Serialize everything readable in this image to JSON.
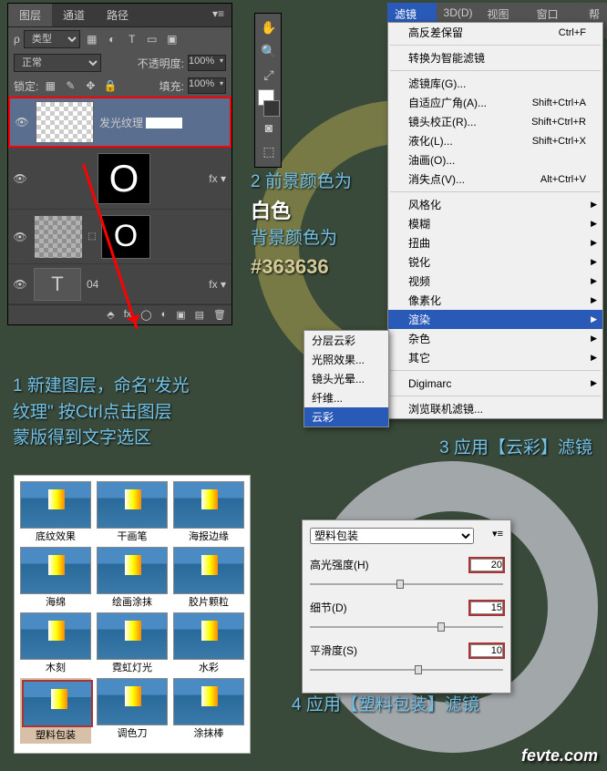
{
  "layers_panel": {
    "tabs": [
      "图层",
      "通道",
      "路径"
    ],
    "kind_label": "类型",
    "blend_mode": "正常",
    "opacity_label": "不透明度:",
    "opacity_value": "100%",
    "lock_label": "锁定:",
    "fill_label": "填充:",
    "fill_value": "100%",
    "layers": [
      {
        "name": "发光纹理",
        "red": true,
        "checker": true,
        "mask": "white",
        "fx": ""
      },
      {
        "name": "",
        "checker": false,
        "mask": "O-black",
        "fx": "fx ▾"
      },
      {
        "name": "",
        "checker": true,
        "mask": "O-black",
        "fx": ""
      },
      {
        "name": "04",
        "type": "T",
        "fx": "fx ▾"
      }
    ]
  },
  "tools": {
    "icons": [
      "✋",
      "🔍",
      "⤢",
      "⬚",
      "⬚",
      "⬚"
    ]
  },
  "swatches": {
    "fg": "#ffffff",
    "bg": "#363636"
  },
  "anno1": {
    "line1": "2 前景颜色为",
    "line2": "白色",
    "line3": "背景颜色为",
    "line4": "#363636"
  },
  "anno2": {
    "line1": "1 新建图层，命名\"发光",
    "line2": "纹理\"  按Ctrl点击图层",
    "line3": "蒙版得到文字选区"
  },
  "anno3": "3  应用【云彩】滤镜",
  "anno4": "4  应用【塑料包装】滤镜",
  "menubar": [
    "滤镜(T)",
    "3D(D)",
    "视图(V)",
    "窗口(W)",
    "帮"
  ],
  "filter_menu": {
    "items": [
      {
        "label": "高反差保留",
        "shortcut": "Ctrl+F"
      },
      {
        "sep": true
      },
      {
        "label": "转换为智能滤镜"
      },
      {
        "sep": true
      },
      {
        "label": "滤镜库(G)..."
      },
      {
        "label": "自适应广角(A)...",
        "shortcut": "Shift+Ctrl+A"
      },
      {
        "label": "镜头校正(R)...",
        "shortcut": "Shift+Ctrl+R"
      },
      {
        "label": "液化(L)...",
        "shortcut": "Shift+Ctrl+X"
      },
      {
        "label": "油画(O)..."
      },
      {
        "label": "消失点(V)...",
        "shortcut": "Alt+Ctrl+V"
      },
      {
        "sep": true
      },
      {
        "label": "风格化",
        "sub": true
      },
      {
        "label": "模糊",
        "sub": true
      },
      {
        "label": "扭曲",
        "sub": true
      },
      {
        "label": "锐化",
        "sub": true
      },
      {
        "label": "视频",
        "sub": true
      },
      {
        "label": "像素化",
        "sub": true
      },
      {
        "label": "渲染",
        "sub": true,
        "hl": true
      },
      {
        "label": "杂色",
        "sub": true
      },
      {
        "label": "其它",
        "sub": true
      },
      {
        "sep": true
      },
      {
        "label": "Digimarc",
        "sub": true
      },
      {
        "sep": true
      },
      {
        "label": "浏览联机滤镜..."
      }
    ]
  },
  "submenu": {
    "items": [
      {
        "label": "分层云彩"
      },
      {
        "label": "光照效果..."
      },
      {
        "label": "镜头光晕..."
      },
      {
        "label": "纤维..."
      },
      {
        "label": "云彩",
        "hl": true
      }
    ]
  },
  "gallery": {
    "rows": [
      [
        "底纹效果",
        "干画笔",
        "海报边缘"
      ],
      [
        "海绵",
        "绘画涂抹",
        "胶片颗粒"
      ],
      [
        "木刻",
        "霓虹灯光",
        "水彩"
      ],
      [
        "塑料包装",
        "调色刀",
        "涂抹棒"
      ]
    ],
    "selected": "塑料包装"
  },
  "plastic_dialog": {
    "title": "塑料包装",
    "params": [
      {
        "label": "高光强度(H)",
        "value": "20",
        "pos": 95
      },
      {
        "label": "细节(D)",
        "value": "15",
        "pos": 140
      },
      {
        "label": "平滑度(S)",
        "value": "10",
        "pos": 115
      }
    ]
  },
  "watermark": "fevte.com"
}
